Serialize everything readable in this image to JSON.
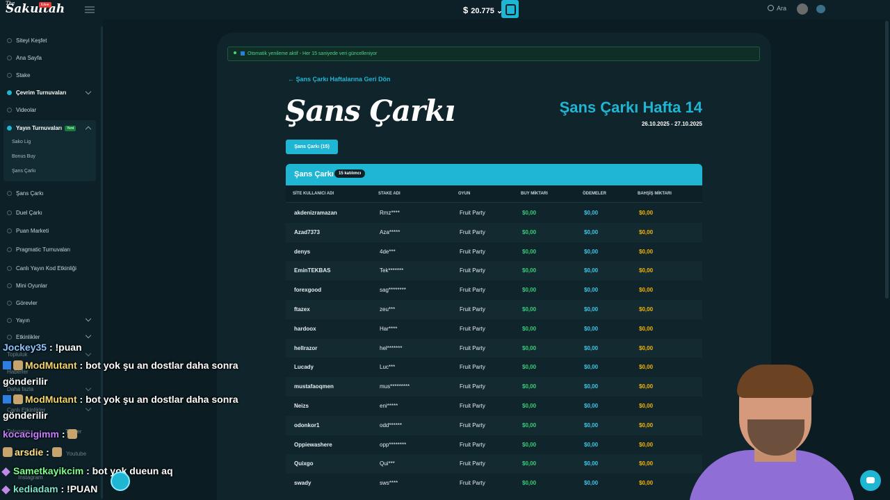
{
  "header": {
    "logo_small": "The",
    "logo": "Sakultah",
    "live": "Live",
    "balance_symbol": "$",
    "balance": "20.775 ⌄",
    "search_label": "Ara"
  },
  "sidebar": {
    "items": [
      {
        "label": "Siteyi Keşfet"
      },
      {
        "label": "Ana Sayfa"
      },
      {
        "label": "Stake"
      },
      {
        "label": "Çevrim Turnuvaları"
      },
      {
        "label": "Videolar"
      },
      {
        "label": "Yayın Turnuvaları"
      },
      {
        "label": "Şans Çarkı"
      },
      {
        "label": "Duel Çarkı"
      },
      {
        "label": "Puan Marketi"
      },
      {
        "label": "Pragmatic Turnuvaları"
      },
      {
        "label": "Canlı Yayın Kod Etkinliği"
      },
      {
        "label": "Mini Oyunlar"
      },
      {
        "label": "Görevler"
      },
      {
        "label": "Yayın"
      },
      {
        "label": "Etkinlikler"
      }
    ],
    "new_badge": "Yeni",
    "sub_items": [
      "Sako Lig",
      "Bonus Buy",
      "Şans Çarkı"
    ]
  },
  "notice": "Otomatik yenileme aktif - Her 15 saniyede veri güncelleniyor",
  "back_link": "← Şans Çarkı Haftalarına Geri Dön",
  "page_title": "Şans Çarkı",
  "week_title": "Şans Çarkı Hafta 14",
  "week_dates": "26.10.2025 - 27.10.2025",
  "tab_label": "Şans Çarkı  (15)",
  "table": {
    "title": "Şans Çarkı",
    "participants": "15 katılımcı",
    "columns": [
      "SİTE KULLANICI ADI",
      "STAKE ADI",
      "OYUN",
      "BUY MİKTARI",
      "ÖDEMELER",
      "BAHŞİŞ MİKTARI"
    ],
    "rows": [
      [
        "akdenizramazan",
        "Rmz****",
        "Fruit Party",
        "$0,00",
        "$0,00",
        "$0,00"
      ],
      [
        "Azad7373",
        "Aza*****",
        "Fruit Party",
        "$0,00",
        "$0,00",
        "$0,00"
      ],
      [
        "denys",
        "4de***",
        "Fruit Party",
        "$0,00",
        "$0,00",
        "$0,00"
      ],
      [
        "EminTEKBAS",
        "Tek*******",
        "Fruit Party",
        "$0,00",
        "$0,00",
        "$0,00"
      ],
      [
        "forexgood",
        "sag********",
        "Fruit Party",
        "$0,00",
        "$0,00",
        "$0,00"
      ],
      [
        "ftazex",
        "zeu***",
        "Fruit Party",
        "$0,00",
        "$0,00",
        "$0,00"
      ],
      [
        "hardoox",
        "Har****",
        "Fruit Party",
        "$0,00",
        "$0,00",
        "$0,00"
      ],
      [
        "hellrazor",
        "hel*******",
        "Fruit Party",
        "$0,00",
        "$0,00",
        "$0,00"
      ],
      [
        "Lucady",
        "Luc***",
        "Fruit Party",
        "$0,00",
        "$0,00",
        "$0,00"
      ],
      [
        "mustafaoqmen",
        "mus*********",
        "Fruit Party",
        "$0,00",
        "$0,00",
        "$0,00"
      ],
      [
        "Neizs",
        "eni*****",
        "Fruit Party",
        "$0,00",
        "$0,00",
        "$0,00"
      ],
      [
        "odonkor1",
        "odd******",
        "Fruit Party",
        "$0,00",
        "$0,00",
        "$0,00"
      ],
      [
        "Oppiewashere",
        "opp********",
        "Fruit Party",
        "$0,00",
        "$0,00",
        "$0,00"
      ],
      [
        "Quixgo",
        "Qui***",
        "Fruit Party",
        "$0,00",
        "$0,00",
        "$0,00"
      ],
      [
        "swady",
        "sws****",
        "Fruit Party",
        "$0,00",
        "$0,00",
        "$0,00"
      ]
    ]
  },
  "chat": [
    {
      "user": "Jockey35",
      "user_color": "#8ec5ff",
      "text": " : !puan"
    },
    {
      "user": "ModMutant",
      "user_color": "#f3d36b",
      "text": " : bot yok şu an dostlar daha sonra",
      "cont": "gönderilir"
    },
    {
      "user": "ModMutant",
      "user_color": "#f3d36b",
      "text": " : bot yok şu an dostlar daha sonra",
      "cont": "gönderilir"
    },
    {
      "user": "kocacigimm",
      "user_color": "#c77dff",
      "text": " : "
    },
    {
      "user": "arsdie",
      "user_color": "#ffe08a",
      "text": " : "
    },
    {
      "user": "Sametkayikcim",
      "user_color": "#7dff8a",
      "text": " : bot yok dueun aq"
    },
    {
      "user": "kediadam",
      "user_color": "#7fe3c9",
      "text": " : !PUAN"
    }
  ],
  "faded_links": [
    "Topluluk",
    "Haberler",
    "Daha fazla",
    "Canlı Etkinlikler",
    "Telegram",
    "Twitter",
    "Youtube",
    "Instagram"
  ]
}
